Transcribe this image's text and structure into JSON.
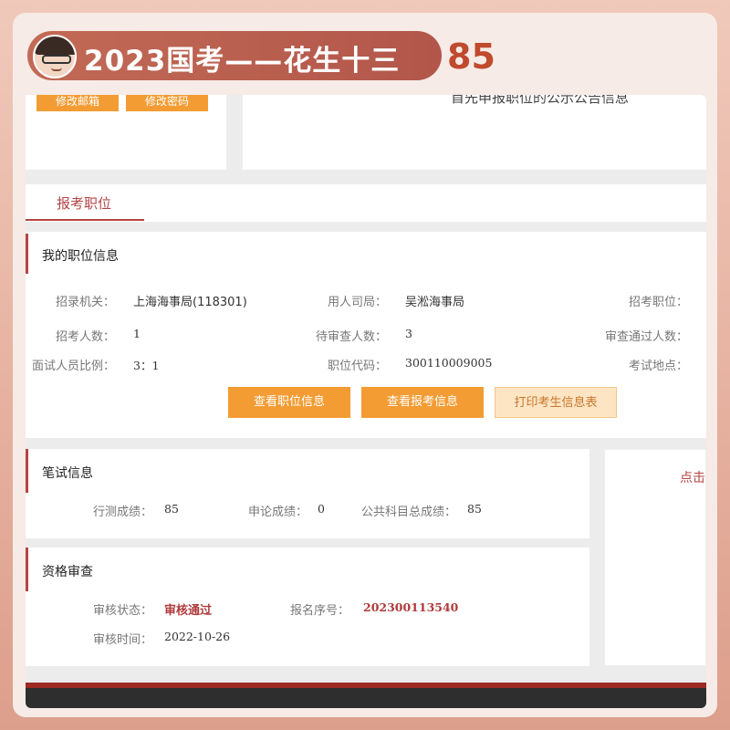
{
  "banner": {
    "title": "2023国考——花生十三",
    "score": "85"
  },
  "account": {
    "edit_email_label": "修改邮箱",
    "edit_password_label": "修改密码"
  },
  "notice": {
    "text": "首先申报职位的公示公告信息"
  },
  "tabs": [
    {
      "label": "报考职位",
      "active": true
    }
  ],
  "position_info": {
    "title": "我的职位信息",
    "fields": {
      "recruiting_agency_label": "招录机关：",
      "recruiting_agency_value": "上海海事局(118301)",
      "employing_bureau_label": "用人司局：",
      "employing_bureau_value": "吴淞海事局",
      "position_label": "招考职位：",
      "quota_label": "招考人数：",
      "quota_value": "1",
      "pending_label": "待审查人数：",
      "pending_value": "3",
      "passed_label": "审查通过人数：",
      "interview_ratio_label": "面试人员比例：",
      "interview_ratio_value": "3：1",
      "position_code_label": "职位代码：",
      "position_code_value": "300110009005",
      "exam_site_label": "考试地点："
    },
    "buttons": {
      "view_position": "查看职位信息",
      "view_application": "查看报考信息",
      "print_form": "打印考生信息表"
    }
  },
  "written_exam": {
    "title": "笔试信息",
    "xingce_label": "行测成绩：",
    "xingce_value": "85",
    "shenlun_label": "申论成绩：",
    "shenlun_value": "0",
    "total_label": "公共科目总成绩：",
    "total_value": "85"
  },
  "qualification": {
    "title": "资格审查",
    "status_label": "审核状态：",
    "status_value": "审核通过",
    "reg_no_label": "报名序号：",
    "reg_no_value": "202300113540",
    "time_label": "审核时间：",
    "time_value": "2022-10-26"
  },
  "side_panel": {
    "link_text": "点击"
  },
  "colors": {
    "accent_red": "#b54444",
    "button_orange": "#f39c33",
    "banner_red": "#b2564a"
  }
}
